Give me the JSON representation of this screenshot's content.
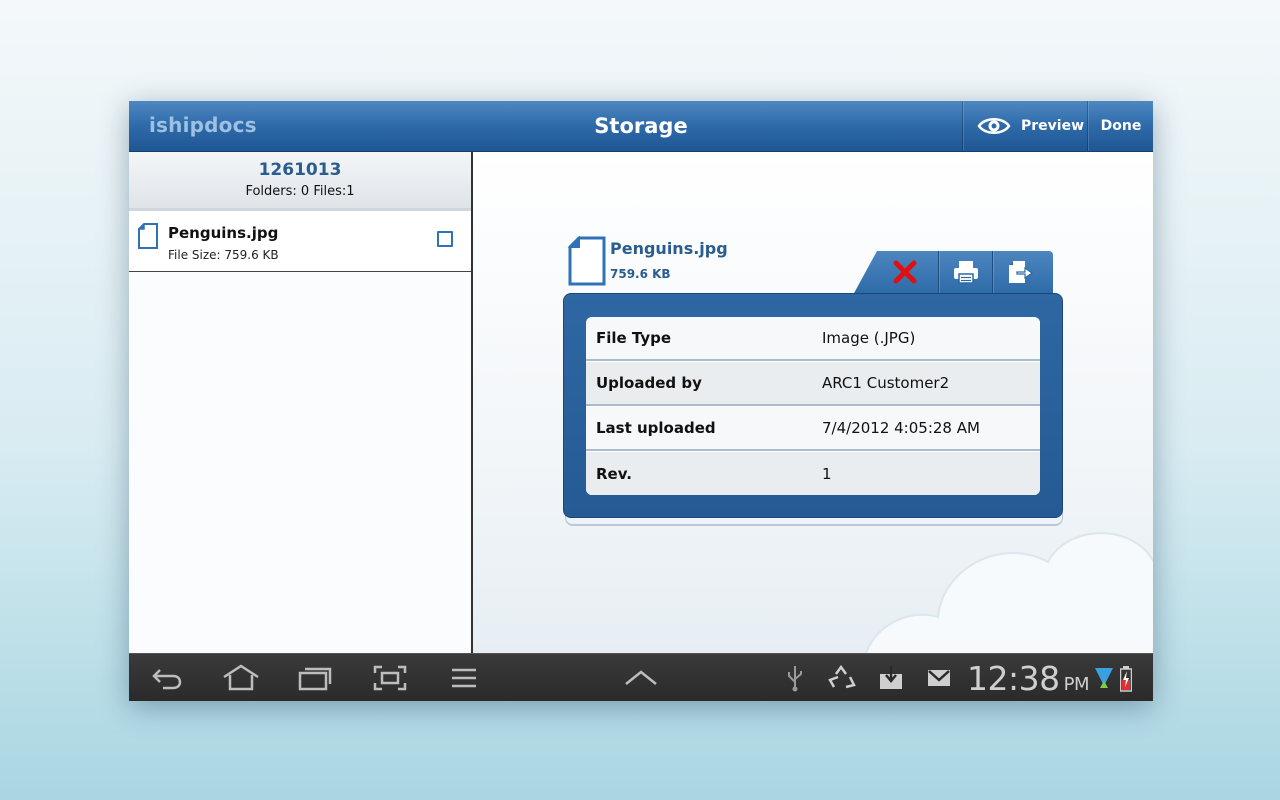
{
  "app": {
    "brand": "ishipdocs",
    "title": "Storage",
    "preview_label": "Preview",
    "done_label": "Done"
  },
  "left_panel": {
    "container_id": "1261013",
    "counts": "Folders: 0  Files:1",
    "files": [
      {
        "name": "Penguins.jpg",
        "size": "File Size: 759.6 KB",
        "checked": false
      }
    ]
  },
  "detail": {
    "file_name": "Penguins.jpg",
    "file_size": "759.6 KB",
    "rows": [
      {
        "label": "File Type",
        "value": "Image (.JPG)"
      },
      {
        "label": "Uploaded by",
        "value": "ARC1 Customer2"
      },
      {
        "label": "Last uploaded",
        "value": "7/4/2012 4:05:28 AM"
      },
      {
        "label": "Rev.",
        "value": "1"
      }
    ],
    "actions": [
      "delete-icon",
      "print-icon",
      "export-icon"
    ]
  },
  "system_bar": {
    "time": "12:38",
    "ampm": "PM",
    "icons": [
      "back-icon",
      "home-icon",
      "recent-apps-icon",
      "screenshot-icon",
      "menu-icon",
      "expand-up-icon",
      "usb-icon",
      "recycle-icon",
      "download-icon",
      "gmail-icon",
      "wifi-icon",
      "battery-icon"
    ]
  },
  "colors": {
    "accent_blue": "#2e6aa9",
    "title_blue": "#2a5d8f",
    "delete_red": "#e01010"
  }
}
